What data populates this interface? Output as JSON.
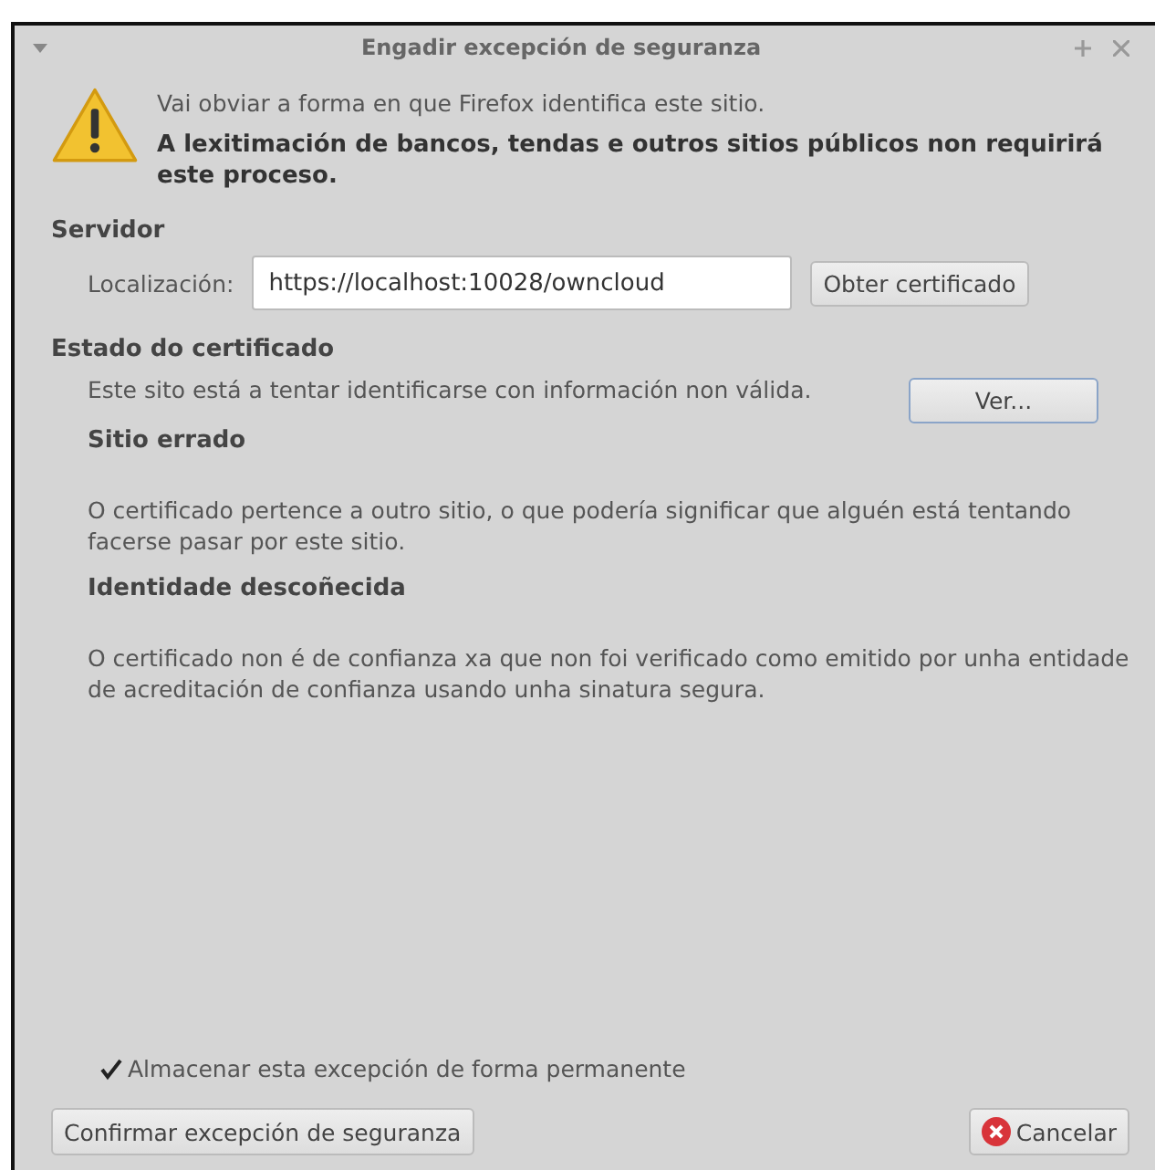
{
  "window": {
    "title": "Engadir excepción de seguranza"
  },
  "warning": {
    "line": "Vai obviar a forma en que Firefox identifica este sitio.",
    "emphasis": "A lexitimación de bancos, tendas e outros sitios públicos non requirirá este proceso."
  },
  "server": {
    "heading": "Servidor",
    "label": "Localización:",
    "value": "https://localhost:10028/owncloud",
    "button": "Obter certificado"
  },
  "status": {
    "heading": "Estado do certificado",
    "summary": "Este sito está a tentar identificarse con información non válida.",
    "button": "Ver...",
    "problems": [
      {
        "title": "Sitio errado",
        "text": "O certificado pertence a outro sitio, o que podería significar que alguén está tentando facerse pasar por este sitio."
      },
      {
        "title": "Identidade descoñecida",
        "text": "O certificado non é de confianza xa que non foi verificado como emitido por unha entidade de acreditación de confianza usando unha sinatura segura."
      }
    ]
  },
  "permanent": {
    "label": "Almacenar esta excepción de forma permanente",
    "checked": true
  },
  "buttons": {
    "confirm": "Confirmar excepción de seguranza",
    "cancel": "Cancelar"
  }
}
